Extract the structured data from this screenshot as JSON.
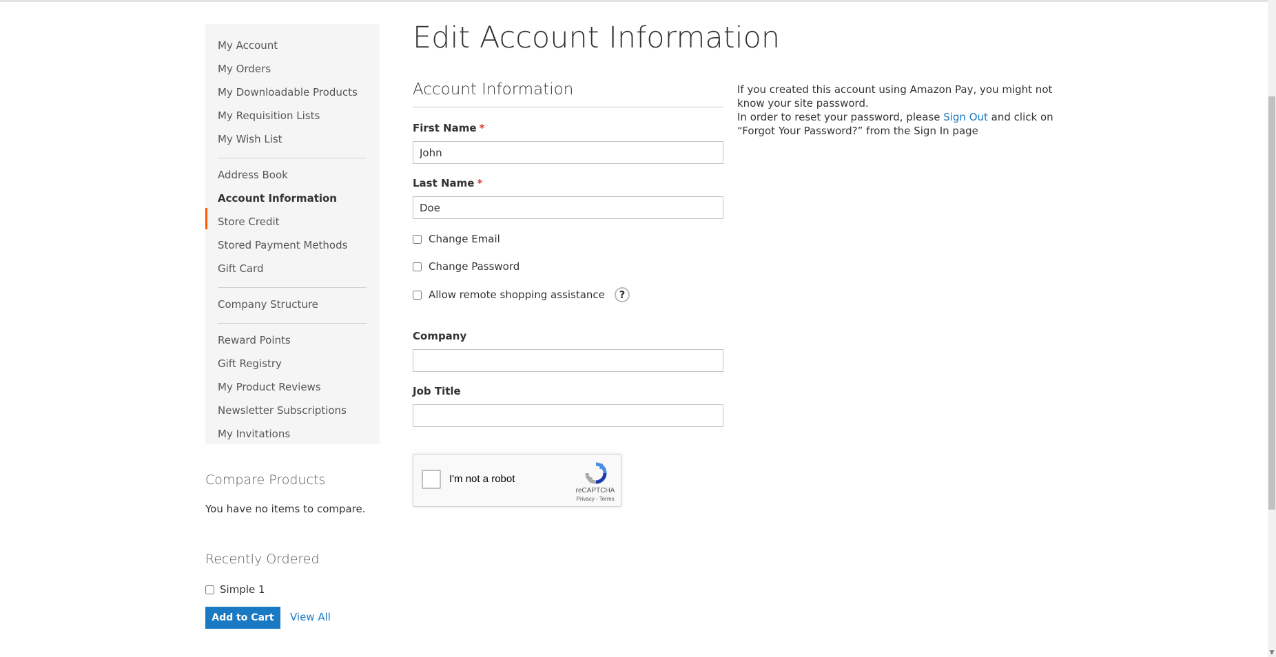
{
  "sidebar": {
    "items": [
      {
        "label": "My Account"
      },
      {
        "label": "My Orders"
      },
      {
        "label": "My Downloadable Products"
      },
      {
        "label": "My Requisition Lists"
      },
      {
        "label": "My Wish List"
      },
      {
        "label": "Address Book"
      },
      {
        "label": "Account Information",
        "active": true
      },
      {
        "label": "Store Credit"
      },
      {
        "label": "Stored Payment Methods"
      },
      {
        "label": "Gift Card"
      },
      {
        "label": "Company Structure"
      },
      {
        "label": "Reward Points"
      },
      {
        "label": "Gift Registry"
      },
      {
        "label": "My Product Reviews"
      },
      {
        "label": "Newsletter Subscriptions"
      },
      {
        "label": "My Invitations"
      }
    ],
    "active_color": "#ff5501"
  },
  "compare": {
    "title": "Compare Products",
    "empty_text": "You have no items to compare."
  },
  "recently_ordered": {
    "title": "Recently Ordered",
    "items": [
      {
        "label": "Simple 1",
        "checked": false
      }
    ],
    "add_to_cart_label": "Add to Cart",
    "view_all_label": "View All"
  },
  "main": {
    "page_title": "Edit Account Information",
    "section_title": "Account Information",
    "first_name": {
      "label": "First Name",
      "required_mark": "*",
      "value": "John"
    },
    "last_name": {
      "label": "Last Name",
      "required_mark": "*",
      "value": "Doe"
    },
    "change_email_label": "Change Email",
    "change_password_label": "Change Password",
    "remote_assistance_label": "Allow remote shopping assistance",
    "company": {
      "label": "Company",
      "value": ""
    },
    "job_title": {
      "label": "Job Title",
      "value": ""
    }
  },
  "recaptcha": {
    "label": "I'm not a robot",
    "brand": "reCAPTCHA",
    "terms": "Privacy - Terms"
  },
  "info_note": {
    "line1": "If you created this account using Amazon Pay, you might not know your site password.",
    "line2_before": "In order to reset your password, please ",
    "sign_out_link": "Sign Out",
    "line2_after": " and click on “Forgot Your Password?” from the Sign In page"
  },
  "colors": {
    "primary": "#1979c3",
    "required": "#e02b27",
    "accent": "#ff5501"
  }
}
